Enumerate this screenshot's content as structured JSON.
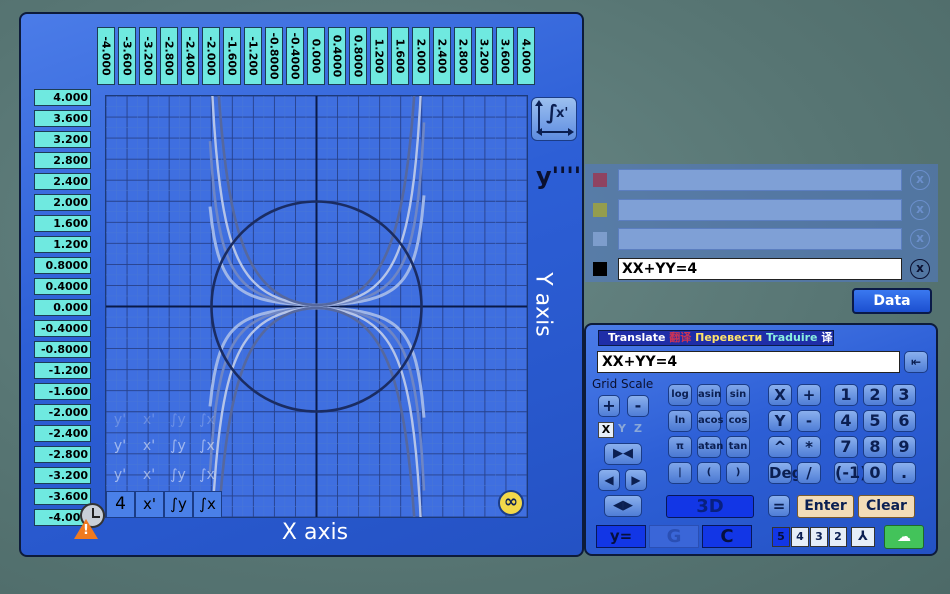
{
  "graph": {
    "y_ticks": [
      "4.000",
      "3.600",
      "3.200",
      "2.800",
      "2.400",
      "2.000",
      "1.600",
      "1.200",
      "0.8000",
      "0.4000",
      "0.000",
      "-0.4000",
      "-0.8000",
      "-1.200",
      "-1.600",
      "-2.000",
      "-2.400",
      "-2.800",
      "-3.200",
      "-3.600",
      "-4.000"
    ],
    "x_ticks": [
      "-4.000",
      "-3.600",
      "-3.200",
      "-2.800",
      "-2.400",
      "-2.000",
      "-1.600",
      "-1.200",
      "-0.8000",
      "-0.4000",
      "0.000",
      "0.4000",
      "0.8000",
      "1.200",
      "1.600",
      "2.000",
      "2.400",
      "2.800",
      "3.200",
      "3.600",
      "4.000"
    ],
    "x_axis_label": "X axis",
    "y_axis_label": "Y axis",
    "derivative_label": "y''''",
    "axis_tool_label": "x'",
    "order_value": "4",
    "row_buttons": [
      "x'",
      "∫y",
      "∫x"
    ],
    "ghost_row1": [
      "y'",
      "x'",
      "∫y",
      "∫x"
    ],
    "ghost_row2": [
      "y'",
      "x'",
      "∫y",
      "∫x"
    ],
    "ghost_row0": [
      "y'",
      "x'",
      "∫y",
      "∫x"
    ]
  },
  "equations": {
    "slots": [
      {
        "color": "#a0304a",
        "text": ""
      },
      {
        "color": "#a8a830",
        "text": ""
      },
      {
        "color": "#8aa8d8",
        "text": ""
      },
      {
        "color": "#000000",
        "text": "XX+YY=4"
      }
    ],
    "clear_icon": "x",
    "data_button": "Data"
  },
  "keypad": {
    "translate": [
      "Translate",
      "翻译",
      "Перевести",
      "Traduire",
      "译"
    ],
    "translate_colors": [
      "#ffffff",
      "#cc3355",
      "#ffe46a",
      "#8af0e0",
      "#ffffff"
    ],
    "input_value": "XX+YY=4",
    "grid_scale_label": "Grid Scale",
    "grid_plus": "+",
    "grid_minus": "-",
    "axes": [
      "X",
      "Y",
      "Z"
    ],
    "funcs": [
      [
        "log",
        "asin",
        "sin"
      ],
      [
        "ln",
        "acos",
        "cos"
      ],
      [
        "π",
        "atan",
        "tan"
      ],
      [
        "|",
        "(",
        ")"
      ]
    ],
    "vars": [
      [
        "X",
        "+"
      ],
      [
        "Y",
        "-"
      ],
      [
        "^",
        "*"
      ],
      [
        "Deg",
        "/"
      ]
    ],
    "digits": [
      [
        "1",
        "2",
        "3"
      ],
      [
        "4",
        "5",
        "6"
      ],
      [
        "7",
        "8",
        "9"
      ],
      [
        "(-1)",
        "0",
        "."
      ]
    ],
    "btn_3d": "3D",
    "btn_equals": "=",
    "btn_enter": "Enter",
    "btn_clear": "Clear",
    "btn_yeq": "y=",
    "btn_g": "G",
    "btn_c": "C",
    "orders": [
      "5",
      "4",
      "3",
      "2"
    ]
  }
}
